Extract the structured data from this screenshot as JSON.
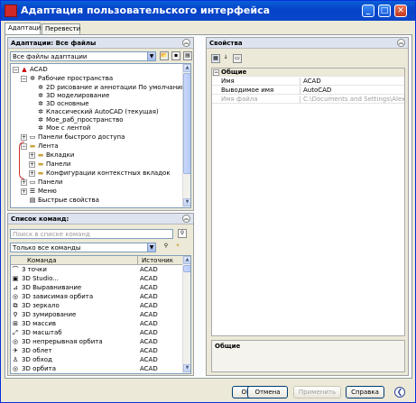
{
  "title": "Адаптация пользовательского интерфейса",
  "tabs": [
    "Адаптация",
    "Перевести"
  ],
  "left_panel": {
    "header": "Адаптации: Все файлы",
    "filter": "Все файлы адаптации",
    "tree": [
      {
        "label": "ACAD",
        "icon": "acad-icon"
      },
      {
        "label": "Рабочие пространства",
        "icon": "gear-icon"
      },
      {
        "label": "2D рисование и аннотации По умолчанию",
        "icon": "gear-icon"
      },
      {
        "label": "3D моделирование",
        "icon": "gear-icon"
      },
      {
        "label": "3D основные",
        "icon": "gear-icon"
      },
      {
        "label": "Классический AutoCAD (текущая)",
        "icon": "gear-icon"
      },
      {
        "label": "Мое_раб_пространство",
        "icon": "gear-icon"
      },
      {
        "label": "Мое с лентой",
        "icon": "gear-icon"
      },
      {
        "label": "Панели быстрого доступа",
        "icon": "toolbar-icon"
      },
      {
        "label": "Лента",
        "icon": "folder-icon"
      },
      {
        "label": "Вкладки",
        "icon": "folder-icon"
      },
      {
        "label": "Панели",
        "icon": "folder-icon"
      },
      {
        "label": "Конфигурации контекстных вкладок",
        "icon": "folder-icon"
      },
      {
        "label": "Панели",
        "icon": "toolbar-icon"
      },
      {
        "label": "Меню",
        "icon": "menu-icon"
      },
      {
        "label": "Быстрые свойства",
        "icon": "properties-icon"
      }
    ]
  },
  "commands": {
    "header": "Список команд:",
    "search_placeholder": "Поиск в списке команд",
    "filter": "Только все команды",
    "columns": [
      "Команда",
      "Источник"
    ],
    "rows": [
      {
        "name": "3 точки",
        "source": "ACAD"
      },
      {
        "name": "3D Studio...",
        "source": "ACAD"
      },
      {
        "name": "3D Выравнивание",
        "source": "ACAD"
      },
      {
        "name": "3D зависимая орбита",
        "source": "ACAD"
      },
      {
        "name": "3D зеркало",
        "source": "ACAD"
      },
      {
        "name": "3D зумирование",
        "source": "ACAD"
      },
      {
        "name": "3D массив",
        "source": "ACAD"
      },
      {
        "name": "3D масштаб",
        "source": "ACAD"
      },
      {
        "name": "3D непрерывная орбита",
        "source": "ACAD"
      },
      {
        "name": "3D облет",
        "source": "ACAD"
      },
      {
        "name": "3D обход",
        "source": "ACAD"
      },
      {
        "name": "3D орбита",
        "source": "ACAD"
      }
    ]
  },
  "properties": {
    "header": "Свойства",
    "category": "Общие",
    "rows": [
      {
        "key": "Имя",
        "value": "ACAD"
      },
      {
        "key": "Выводимое имя",
        "value": "AutoCAD"
      },
      {
        "key": "Имя файла",
        "value": "C:\\Documents and Settings\\Alexander"
      }
    ],
    "footer_title": "Общие"
  },
  "buttons": {
    "ok": "OK",
    "cancel": "Отмена",
    "apply": "Применить",
    "help": "Справка"
  }
}
